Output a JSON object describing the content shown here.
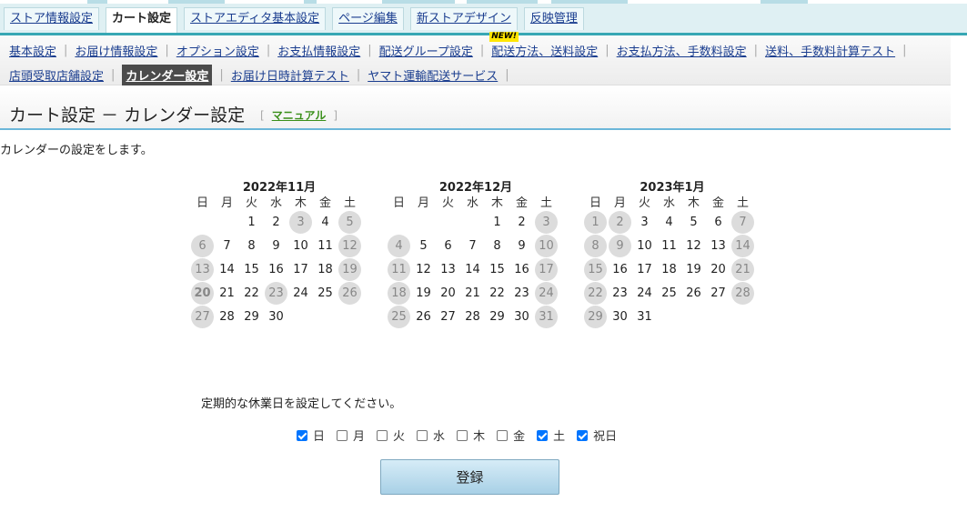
{
  "top_tabs": [
    {
      "label": "ストア情報設定",
      "active": false
    },
    {
      "label": "カート設定",
      "active": true
    },
    {
      "label": "ストアエディタ基本設定",
      "active": false
    },
    {
      "label": "ページ編集",
      "active": false
    },
    {
      "label": "新ストアデザイン",
      "active": false
    },
    {
      "label": "反映管理",
      "active": false
    }
  ],
  "subnav": {
    "row1": [
      "基本設定",
      "お届け情報設定",
      "オプション設定",
      "お支払情報設定",
      "配送グループ設定",
      "配送方法、送料設定",
      "お支払方法、手数料設定",
      "送料、手数料計算テスト"
    ],
    "row2": [
      "店頭受取店舗設定",
      "カレンダー設定",
      "お届け日時計算テスト",
      "ヤマト運輸配送サービス"
    ],
    "new_badge": "NEW!",
    "current": "カレンダー設定"
  },
  "page": {
    "title": "カート設定 － カレンダー設定",
    "manual_label": "マニュアル",
    "description": "カレンダーの設定をします。"
  },
  "weekday_headers": [
    "日",
    "月",
    "火",
    "水",
    "木",
    "金",
    "土"
  ],
  "calendars": [
    {
      "caption": "2022年11月",
      "weeks": [
        [
          null,
          null,
          1,
          2,
          3,
          4,
          5
        ],
        [
          6,
          7,
          8,
          9,
          10,
          11,
          12
        ],
        [
          13,
          14,
          15,
          16,
          17,
          18,
          19
        ],
        [
          20,
          21,
          22,
          23,
          24,
          25,
          26
        ],
        [
          27,
          28,
          29,
          30,
          null,
          null,
          null
        ]
      ],
      "holidays": [
        3,
        5,
        6,
        12,
        13,
        19,
        20,
        23,
        26,
        27
      ],
      "today": 20
    },
    {
      "caption": "2022年12月",
      "weeks": [
        [
          null,
          null,
          null,
          null,
          1,
          2,
          3
        ],
        [
          4,
          5,
          6,
          7,
          8,
          9,
          10
        ],
        [
          11,
          12,
          13,
          14,
          15,
          16,
          17
        ],
        [
          18,
          19,
          20,
          21,
          22,
          23,
          24
        ],
        [
          25,
          26,
          27,
          28,
          29,
          30,
          31
        ]
      ],
      "holidays": [
        3,
        4,
        10,
        11,
        17,
        18,
        24,
        25,
        31
      ],
      "today": null
    },
    {
      "caption": "2023年1月",
      "weeks": [
        [
          1,
          2,
          3,
          4,
          5,
          6,
          7
        ],
        [
          8,
          9,
          10,
          11,
          12,
          13,
          14
        ],
        [
          15,
          16,
          17,
          18,
          19,
          20,
          21
        ],
        [
          22,
          23,
          24,
          25,
          26,
          27,
          28
        ],
        [
          29,
          30,
          31,
          null,
          null,
          null,
          null
        ]
      ],
      "holidays": [
        1,
        2,
        7,
        8,
        9,
        14,
        15,
        21,
        22,
        28,
        29
      ],
      "today": null
    }
  ],
  "regular_holidays": {
    "prompt": "定期的な休業日を設定してください。",
    "options": [
      {
        "label": "日",
        "checked": true
      },
      {
        "label": "月",
        "checked": false
      },
      {
        "label": "火",
        "checked": false
      },
      {
        "label": "水",
        "checked": false
      },
      {
        "label": "木",
        "checked": false
      },
      {
        "label": "金",
        "checked": false
      },
      {
        "label": "土",
        "checked": true
      },
      {
        "label": "祝日",
        "checked": true
      }
    ]
  },
  "submit_label": "登録",
  "colors": {
    "accent": "#37a7b4",
    "holiday_circle": "#dcdcdc",
    "checkbox": "#0075ff",
    "link": "#1a3d8f"
  }
}
